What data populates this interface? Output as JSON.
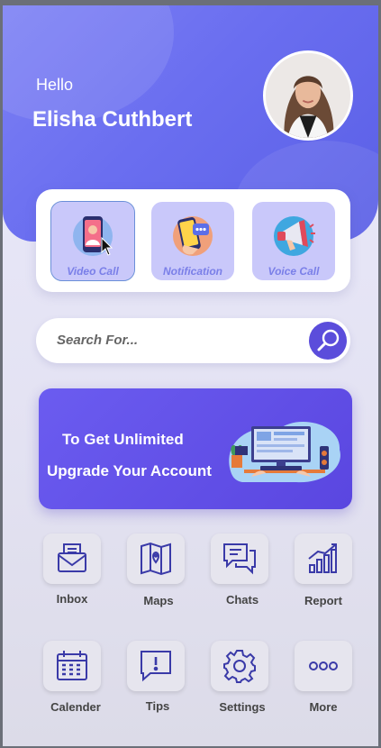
{
  "greeting": "Hello",
  "user": {
    "name": "Elisha Cuthbert"
  },
  "quick_actions": [
    {
      "label": "Video Call",
      "icon": "video-call-icon"
    },
    {
      "label": "Notification",
      "icon": "notification-icon"
    },
    {
      "label": "Voice Call",
      "icon": "megaphone-icon"
    }
  ],
  "search": {
    "placeholder": "Search For..."
  },
  "promo": {
    "line1": "To Get Unlimited",
    "line2": "Upgrade Your Account"
  },
  "menu": [
    {
      "label": "Inbox",
      "icon": "inbox-icon"
    },
    {
      "label": "Maps",
      "icon": "map-icon"
    },
    {
      "label": "Chats",
      "icon": "chat-icon"
    },
    {
      "label": "Report",
      "icon": "report-icon"
    },
    {
      "label": "Calender",
      "icon": "calendar-icon"
    },
    {
      "label": "Tips",
      "icon": "tips-icon"
    },
    {
      "label": "Settings",
      "icon": "settings-icon"
    },
    {
      "label": "More",
      "icon": "more-icon"
    }
  ],
  "colors": {
    "accent": "#5b4ddb",
    "header": "#6a6ef0",
    "tile_label": "#7a7fe8"
  }
}
